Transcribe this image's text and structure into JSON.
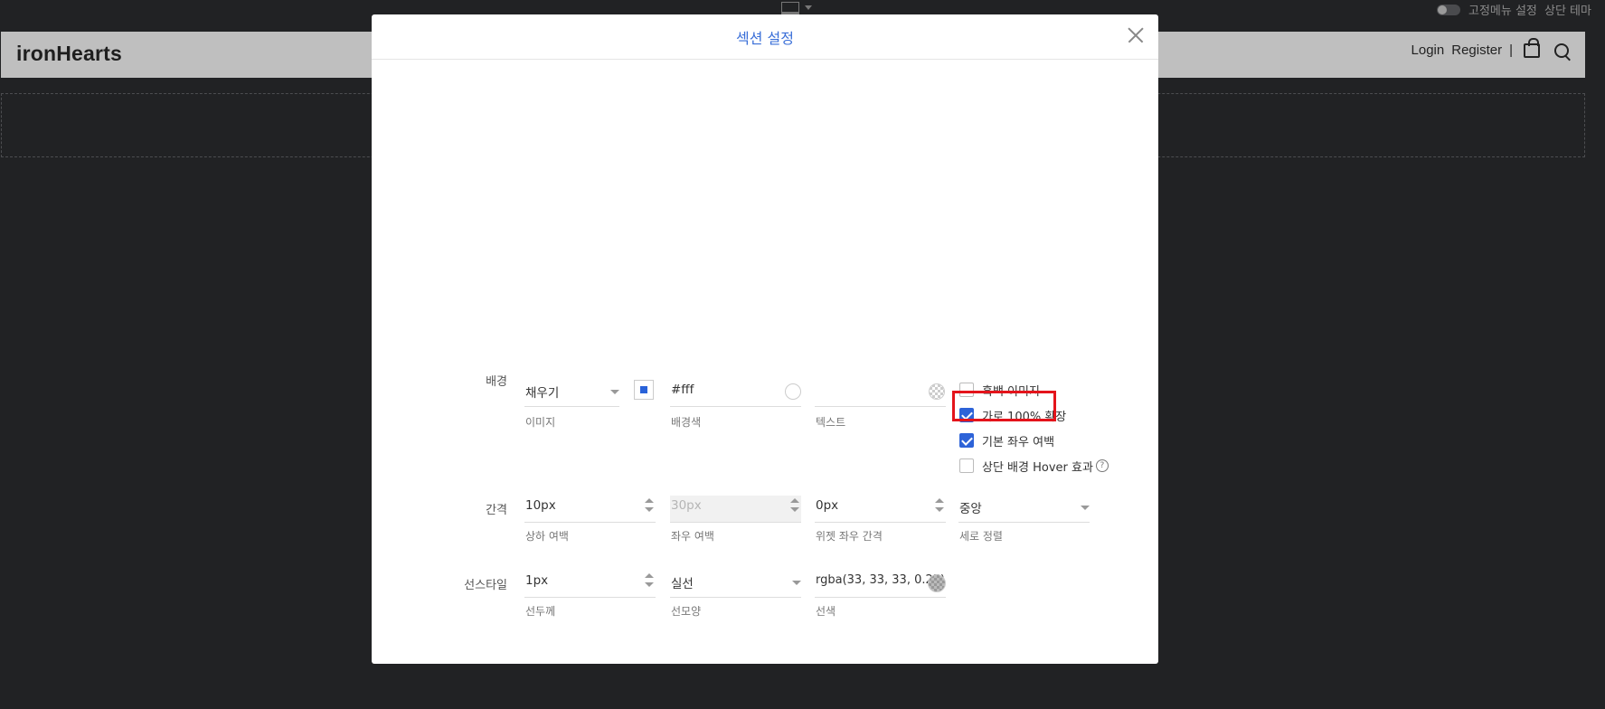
{
  "topbar": {
    "fixed_menu_label": "고정메뉴 설정",
    "top_theme_label": "상단 테마"
  },
  "site": {
    "logo": "ironHearts",
    "login": "Login",
    "register": "Register",
    "separator": "|"
  },
  "modal": {
    "title": "섹션 설정",
    "background": {
      "label": "배경",
      "image_value": "채우기",
      "image_sub": "이미지",
      "bgcolor_value": "#fff",
      "bgcolor_sub": "배경색",
      "text_value": "",
      "text_sub": "텍스트"
    },
    "options": [
      {
        "label": "흑백 이미지",
        "checked": false
      },
      {
        "label": "가로 100% 확장",
        "checked": true
      },
      {
        "label": "기본 좌우 여백",
        "checked": true
      },
      {
        "label": "상단 배경 Hover 효과",
        "checked": false
      }
    ],
    "help_glyph": "?",
    "spacing": {
      "label": "간격",
      "vertical_value": "10px",
      "vertical_sub": "상하 여백",
      "horizontal_value": "30px",
      "horizontal_sub": "좌우 여백",
      "widget_value": "0px",
      "widget_sub": "위젯 좌우 간격",
      "align_value": "중앙",
      "align_sub": "세로 정렬"
    },
    "line_style": {
      "label": "선스타일",
      "width_value": "1px",
      "width_sub": "선두께",
      "shape_value": "실선",
      "shape_sub": "선모양",
      "color_value": "rgba(33, 33, 33, 0.25)",
      "color_sub": "선색"
    }
  },
  "colors": {
    "accent": "#2d63d8",
    "highlight": "#e4141b",
    "title": "#3a6fd8"
  }
}
